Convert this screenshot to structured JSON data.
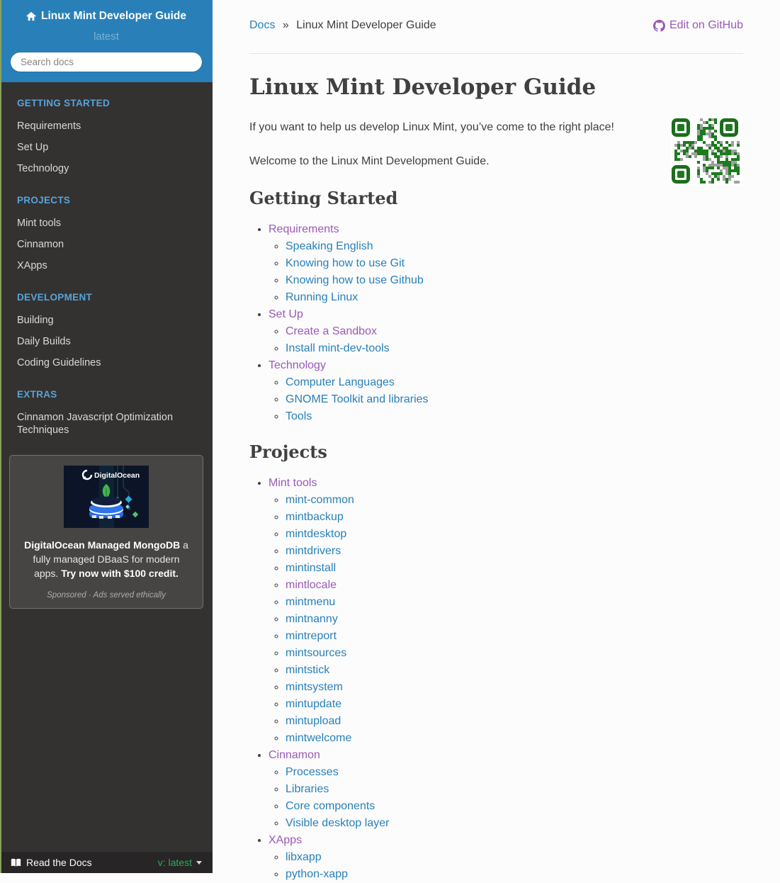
{
  "colors": {
    "link": "#2980b9",
    "link_visited": "#9b59b6",
    "caption": "#55a5d9",
    "version_green": "#27ae60",
    "header_blue": "#2980b9"
  },
  "sidebar": {
    "title": "Linux Mint Developer Guide",
    "version": "latest",
    "search_placeholder": "Search docs",
    "sections": [
      {
        "caption": "GETTING STARTED",
        "items": [
          "Requirements",
          "Set Up",
          "Technology"
        ]
      },
      {
        "caption": "PROJECTS",
        "items": [
          "Mint tools",
          "Cinnamon",
          "XApps"
        ]
      },
      {
        "caption": "DEVELOPMENT",
        "items": [
          "Building",
          "Daily Builds",
          "Coding Guidelines"
        ]
      },
      {
        "caption": "EXTRAS",
        "items": [
          "Cinnamon Javascript Optimization Techniques"
        ]
      }
    ]
  },
  "ad": {
    "image_brand": "DigitalOcean",
    "bold_lead": "DigitalOcean Managed MongoDB",
    "body": " a fully managed DBaaS for modern apps. ",
    "bold_cta": "Try now with $100 credit.",
    "footer": "Sponsored · Ads served ethically"
  },
  "footer": {
    "brand": "Read the Docs",
    "version_label": "v: latest"
  },
  "breadcrumb": {
    "docs": "Docs",
    "separator": "»",
    "current": "Linux Mint Developer Guide",
    "edit_label": "Edit on GitHub"
  },
  "content": {
    "title": "Linux Mint Developer Guide",
    "paragraphs": [
      "If you want to help us develop Linux Mint, you’ve come to the right place!",
      "Welcome to the Linux Mint Development Guide."
    ],
    "sections": [
      {
        "heading": "Getting Started",
        "items": [
          {
            "label": "Requirements",
            "visited": true,
            "children": [
              {
                "label": "Speaking English"
              },
              {
                "label": "Knowing how to use Git"
              },
              {
                "label": "Knowing how to use Github"
              },
              {
                "label": "Running Linux"
              }
            ]
          },
          {
            "label": "Set Up",
            "visited": true,
            "children": [
              {
                "label": "Create a Sandbox",
                "visited": true
              },
              {
                "label": "Install mint-dev-tools"
              }
            ]
          },
          {
            "label": "Technology",
            "visited": true,
            "children": [
              {
                "label": "Computer Languages"
              },
              {
                "label": "GNOME Toolkit and libraries"
              },
              {
                "label": "Tools"
              }
            ]
          }
        ]
      },
      {
        "heading": "Projects",
        "items": [
          {
            "label": "Mint tools",
            "visited": true,
            "children": [
              {
                "label": "mint-common"
              },
              {
                "label": "mintbackup"
              },
              {
                "label": "mintdesktop"
              },
              {
                "label": "mintdrivers"
              },
              {
                "label": "mintinstall"
              },
              {
                "label": "mintlocale",
                "visited": true
              },
              {
                "label": "mintmenu"
              },
              {
                "label": "mintnanny"
              },
              {
                "label": "mintreport"
              },
              {
                "label": "mintsources"
              },
              {
                "label": "mintstick"
              },
              {
                "label": "mintsystem"
              },
              {
                "label": "mintupdate"
              },
              {
                "label": "mintupload"
              },
              {
                "label": "mintwelcome"
              }
            ]
          },
          {
            "label": "Cinnamon",
            "visited": true,
            "children": [
              {
                "label": "Processes"
              },
              {
                "label": "Libraries"
              },
              {
                "label": "Core components"
              },
              {
                "label": "Visible desktop layer"
              }
            ]
          },
          {
            "label": "XApps",
            "visited": true,
            "children": [
              {
                "label": "libxapp"
              },
              {
                "label": "python-xapp"
              }
            ]
          }
        ]
      }
    ]
  }
}
